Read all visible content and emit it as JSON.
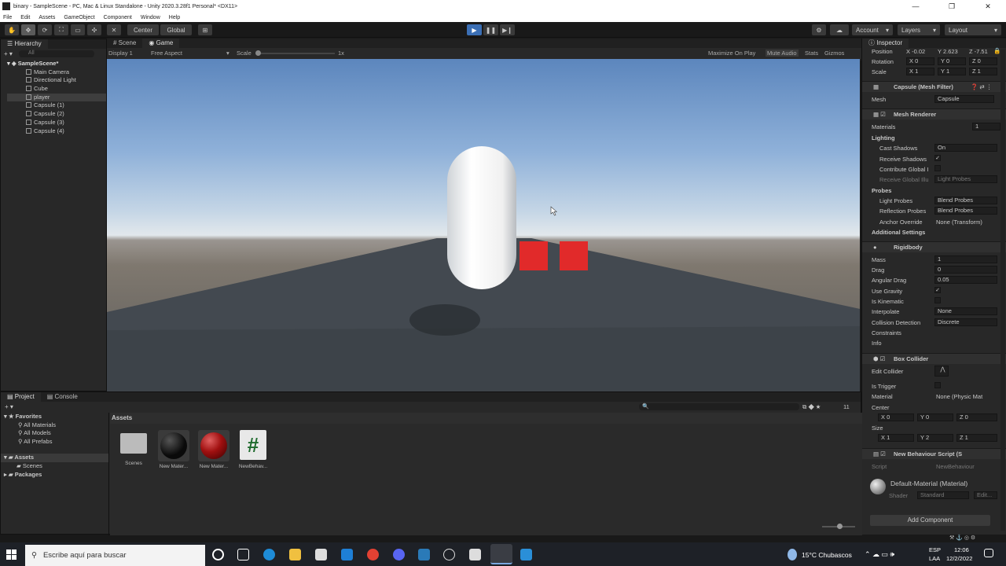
{
  "window": {
    "title": "binary - SampleScene - PC, Mac & Linux Standalone - Unity 2020.3.28f1 Personal* <DX11>",
    "minimize": "—",
    "maximize": "❐",
    "close": "✕"
  },
  "menu": [
    "File",
    "Edit",
    "Assets",
    "GameObject",
    "Component",
    "Window",
    "Help"
  ],
  "toolbar": {
    "center": "Center",
    "global": "Global",
    "account": "Account",
    "layers": "Layers",
    "layout": "Layout"
  },
  "hierarchy": {
    "tab": "Hierarchy",
    "search": "All",
    "scene": "SampleScene*",
    "items": [
      "Main Camera",
      "Directional Light",
      "Cube",
      "player",
      "Capsule (1)",
      "Capsule (2)",
      "Capsule (3)",
      "Capsule (4)"
    ]
  },
  "game": {
    "tabs": [
      "Scene",
      "Game"
    ],
    "display": "Display 1",
    "aspect": "Free Aspect",
    "scale_label": "Scale",
    "scale_value": "1x",
    "maximize": "Maximize On Play",
    "mute": "Mute Audio",
    "stats": "Stats",
    "gizmos": "Gizmos"
  },
  "inspector": {
    "tab": "Inspector",
    "transform": {
      "position_label": "Position",
      "px": "X -0.02",
      "py": "Y 2.623",
      "pz": "Z -7.51",
      "rotation_label": "Rotation",
      "rx": "X 0",
      "ry": "Y 0",
      "rz": "Z 0",
      "scale_label": "Scale",
      "sx": "X 1",
      "sy": "Y 1",
      "sz": "Z 1"
    },
    "mesh_filter": {
      "title": "Capsule (Mesh Filter)",
      "mesh_label": "Mesh",
      "mesh_value": "Capsule"
    },
    "mesh_renderer": {
      "title": "Mesh Renderer",
      "materials": "Materials",
      "materials_count": "1",
      "lighting": "Lighting",
      "cast_shadows": "Cast Shadows",
      "cast_value": "On",
      "receive_shadows": "Receive Shadows",
      "contribute_gi": "Contribute Global I",
      "receive_gi": "Receive Global Illu",
      "receive_gi_value": "Light Probes",
      "probes": "Probes",
      "light_probes": "Light Probes",
      "light_probes_value": "Blend Probes",
      "reflection_probes": "Reflection Probes",
      "reflection_value": "Blend Probes",
      "anchor": "Anchor Override",
      "anchor_value": "None (Transform)",
      "additional": "Additional Settings"
    },
    "rigidbody": {
      "title": "Rigidbody",
      "mass": "Mass",
      "mass_v": "1",
      "drag": "Drag",
      "drag_v": "0",
      "ang_drag": "Angular Drag",
      "ang_drag_v": "0.05",
      "use_gravity": "Use Gravity",
      "is_kinematic": "Is Kinematic",
      "interpolate": "Interpolate",
      "interpolate_v": "None",
      "collision": "Collision Detection",
      "collision_v": "Discrete",
      "constraints": "Constraints",
      "info": "Info"
    },
    "box_collider": {
      "title": "Box Collider",
      "edit": "Edit Collider",
      "is_trigger": "Is Trigger",
      "material": "Material",
      "material_v": "None (Physic Mat",
      "center": "Center",
      "cx": "X 0",
      "cy": "Y 0",
      "cz": "Z 0",
      "size": "Size",
      "szx": "X 1",
      "szy": "Y 2",
      "szz": "Z 1"
    },
    "script": {
      "title": "New Behaviour Script (S",
      "label": "Script",
      "value": "NewBehaviour"
    },
    "material": {
      "title": "Default-Material (Material)",
      "shader_label": "Shader",
      "shader_value": "Standard",
      "edit": "Edit..."
    },
    "add_component": "Add Component"
  },
  "project": {
    "tabs": [
      "Project",
      "Console"
    ],
    "favorites": "Favorites",
    "fav_items": [
      "All Materials",
      "All Models",
      "All Prefabs"
    ],
    "assets_root": "Assets",
    "scenes": "Scenes",
    "packages": "Packages",
    "header": "Assets",
    "hidden_count": "11",
    "items": [
      {
        "label": "Scenes"
      },
      {
        "label": "New Mater..."
      },
      {
        "label": "New Mater..."
      },
      {
        "label": "NewBehav..."
      }
    ]
  },
  "taskbar": {
    "search": "Escribe aquí para buscar",
    "weather": "15°C  Chubascos",
    "lang1": "ESP",
    "lang2": "LAA",
    "time": "12:06",
    "date": "12/2/2022"
  },
  "colors": {
    "accent": "#3b6fb5",
    "cube": "#e12a2a",
    "mat_red": "#a01010"
  }
}
